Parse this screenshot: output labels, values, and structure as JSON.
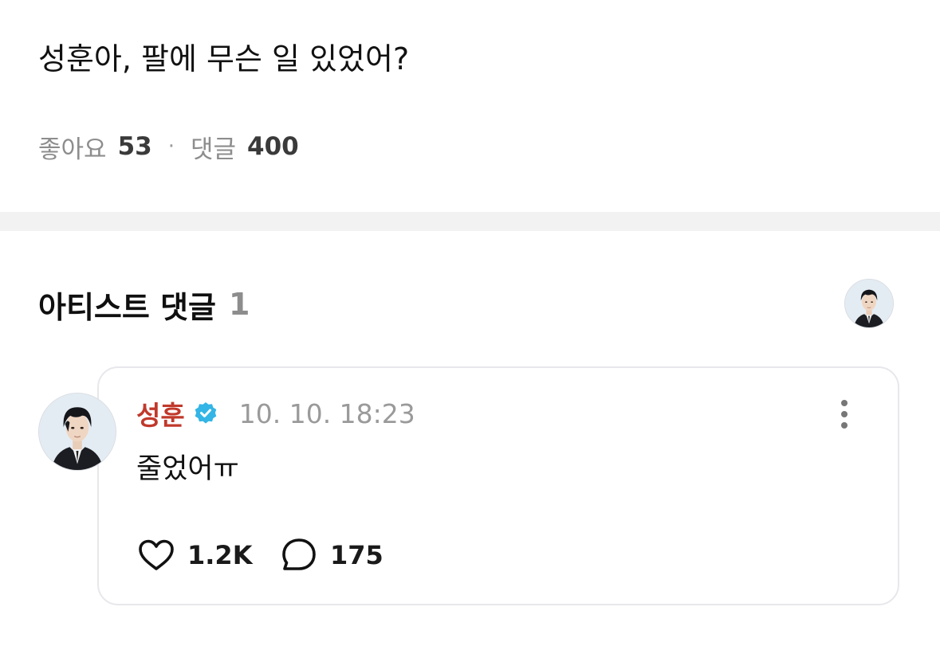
{
  "post": {
    "text": "성훈아, 팔에 무슨 일 있었어?",
    "likes_label": "좋아요",
    "likes_count": "53",
    "separator": "·",
    "comments_label": "댓글",
    "comments_count": "400"
  },
  "artist_comments": {
    "title": "아티스트 댓글",
    "count": "1"
  },
  "comment": {
    "author": "성훈",
    "verified": true,
    "timestamp": "10. 10. 18:23",
    "text": "줄었어ㅠ",
    "likes": "1.2K",
    "replies": "175"
  },
  "colors": {
    "author_name": "#c0392b",
    "verified_badge": "#33b5e5",
    "divider": "#f2f2f2",
    "card_border": "#e7e7ec"
  },
  "icons": {
    "verified": "verified-badge-icon",
    "more": "more-vertical-icon",
    "like": "heart-outline-icon",
    "reply": "speech-bubble-icon"
  }
}
